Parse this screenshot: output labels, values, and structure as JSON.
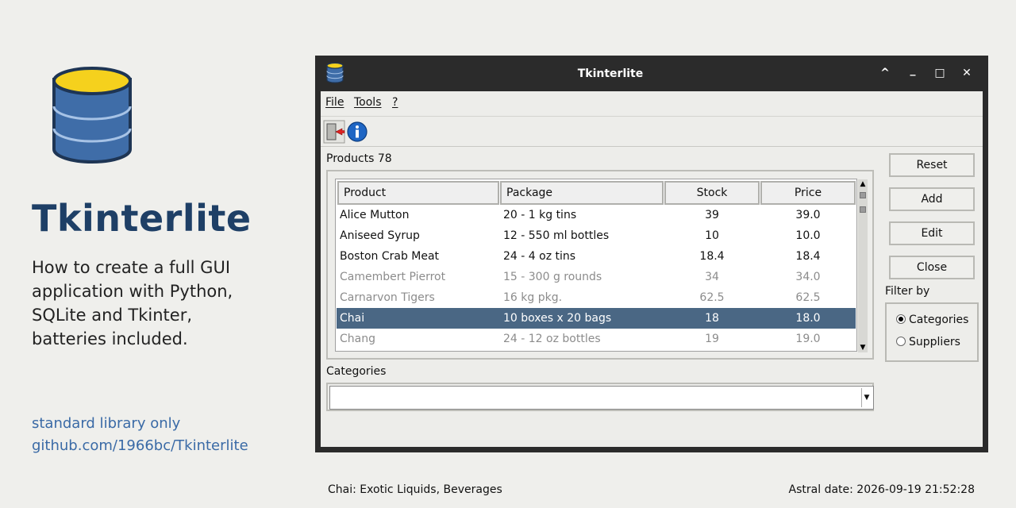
{
  "hero": {
    "title": "Tkinterlite",
    "description_lines": [
      "How to create a full GUI",
      "application with Python,",
      "SQLite and Tkinter,",
      "batteries included."
    ],
    "link1": "standard library only",
    "link2": "github.com/1966bc/Tkinterlite"
  },
  "window": {
    "title": "Tkinterlite",
    "controls": {
      "up": "^",
      "minimize": "_",
      "maximize": "□",
      "close": "✕"
    }
  },
  "menu": {
    "file": "File",
    "tools": "Tools",
    "help": "?"
  },
  "toolbar": {
    "exit_icon": "exit-door-icon",
    "info_icon": "info-icon"
  },
  "products": {
    "label": "Products 78",
    "columns": [
      "Product",
      "Package",
      "Stock",
      "Price"
    ],
    "rows": [
      {
        "product": "Alice Mutton",
        "package": "20 - 1 kg tins",
        "stock": "39",
        "price": "39.0",
        "state": "normal"
      },
      {
        "product": "Aniseed Syrup",
        "package": "12 - 550 ml bottles",
        "stock": "10",
        "price": "10.0",
        "state": "normal"
      },
      {
        "product": "Boston Crab Meat",
        "package": "24 - 4 oz tins",
        "stock": "18.4",
        "price": "18.4",
        "state": "normal"
      },
      {
        "product": "Camembert Pierrot",
        "package": "15 - 300 g rounds",
        "stock": "34",
        "price": "34.0",
        "state": "dim"
      },
      {
        "product": "Carnarvon Tigers",
        "package": "16 kg pkg.",
        "stock": "62.5",
        "price": "62.5",
        "state": "dim"
      },
      {
        "product": "Chai",
        "package": "10 boxes x 20 bags",
        "stock": "18",
        "price": "18.0",
        "state": "selected"
      },
      {
        "product": "Chang",
        "package": "24 - 12 oz bottles",
        "stock": "19",
        "price": "19.0",
        "state": "dim"
      }
    ]
  },
  "categories": {
    "label": "Categories",
    "value": ""
  },
  "buttons": {
    "reset": "Reset",
    "add": "Add",
    "edit": "Edit",
    "close": "Close"
  },
  "filter": {
    "label": "Filter by",
    "options": [
      "Categories",
      "Suppliers"
    ],
    "selected": "Categories"
  },
  "status": {
    "left": "Chai: Exotic Liquids, Beverages",
    "right": "Astral date: 2026-09-19 21:52:28"
  },
  "colors": {
    "accent": "#1e3f66",
    "selection": "#4a6784",
    "link": "#3a6aa6",
    "db_blue": "#3f6da8",
    "db_yellow": "#f5d11d"
  }
}
